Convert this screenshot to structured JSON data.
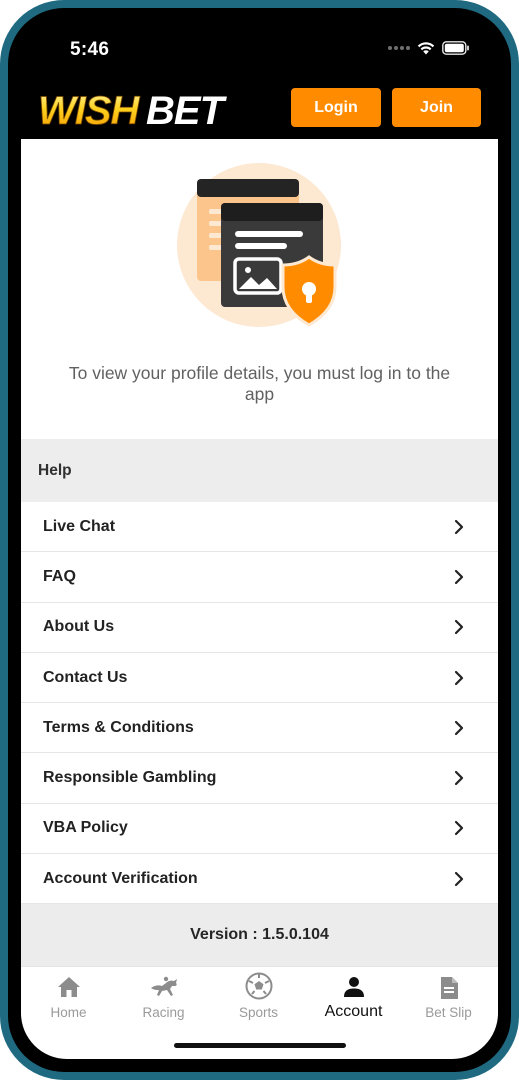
{
  "status_bar": {
    "time": "5:46"
  },
  "header": {
    "logo_text": "WISHBET",
    "login_label": "Login",
    "join_label": "Join",
    "accent_color": "#ff8c00"
  },
  "hero": {
    "message": "To view your profile details, you must log in to the app",
    "illustration": "profile-lock-illustration"
  },
  "help": {
    "title": "Help",
    "items": [
      {
        "label": "Live Chat"
      },
      {
        "label": "FAQ"
      },
      {
        "label": "About Us"
      },
      {
        "label": "Contact Us"
      },
      {
        "label": "Terms & Conditions"
      },
      {
        "label": "Responsible Gambling"
      },
      {
        "label": "VBA Policy"
      },
      {
        "label": "Account Verification"
      }
    ]
  },
  "version": "Version : 1.5.0.104",
  "bottom_nav": {
    "active": "Account",
    "items": [
      {
        "label": "Home",
        "icon": "home-icon"
      },
      {
        "label": "Racing",
        "icon": "horse-racing-icon"
      },
      {
        "label": "Sports",
        "icon": "soccer-ball-icon"
      },
      {
        "label": "Account",
        "icon": "person-icon"
      },
      {
        "label": "Bet Slip",
        "icon": "document-icon"
      }
    ]
  }
}
